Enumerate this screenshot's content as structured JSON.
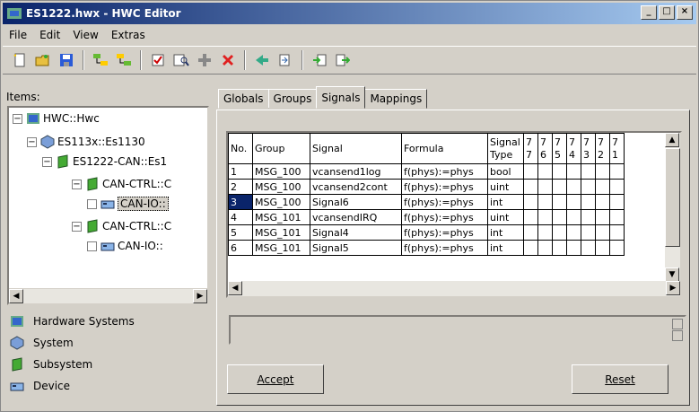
{
  "window": {
    "title": "ES1222.hwx - HWC Editor"
  },
  "menu": [
    "File",
    "Edit",
    "View",
    "Extras"
  ],
  "items_label": "Items:",
  "tree": {
    "root": "HWC::Hwc",
    "system": "ES113x::Es1130",
    "subsystem": "ES1222-CAN::Es1",
    "ctrl1": "CAN-CTRL::C",
    "io1": "CAN-IO::",
    "ctrl2": "CAN-CTRL::C",
    "io2": "CAN-IO::"
  },
  "legend": {
    "hardware_systems": "Hardware Systems",
    "system": "System",
    "subsystem": "Subsystem",
    "device": "Device"
  },
  "tabs": [
    "Globals",
    "Groups",
    "Signals",
    "Mappings"
  ],
  "grid": {
    "headers": [
      "No.",
      "Group",
      "Signal",
      "Formula",
      "Signal Type",
      "7 7",
      "7 6",
      "7 5",
      "7 4",
      "7 3",
      "7 2",
      "7 1"
    ],
    "rows": [
      [
        "1",
        "MSG_100",
        "vcansend1log",
        "f(phys):=phys",
        "bool"
      ],
      [
        "2",
        "MSG_100",
        "vcansend2cont",
        "f(phys):=phys",
        "uint"
      ],
      [
        "3",
        "MSG_100",
        "Signal6",
        "f(phys):=phys",
        "int"
      ],
      [
        "4",
        "MSG_101",
        "vcansendIRQ",
        "f(phys):=phys",
        "uint"
      ],
      [
        "5",
        "MSG_101",
        "Signal4",
        "f(phys):=phys",
        "int"
      ],
      [
        "6",
        "MSG_101",
        "Signal5",
        "f(phys):=phys",
        "int"
      ]
    ]
  },
  "buttons": {
    "accept": "Accept",
    "reset": "Reset"
  },
  "colors": {
    "titlebar": "#0a246a",
    "selection": "#0a246a"
  }
}
